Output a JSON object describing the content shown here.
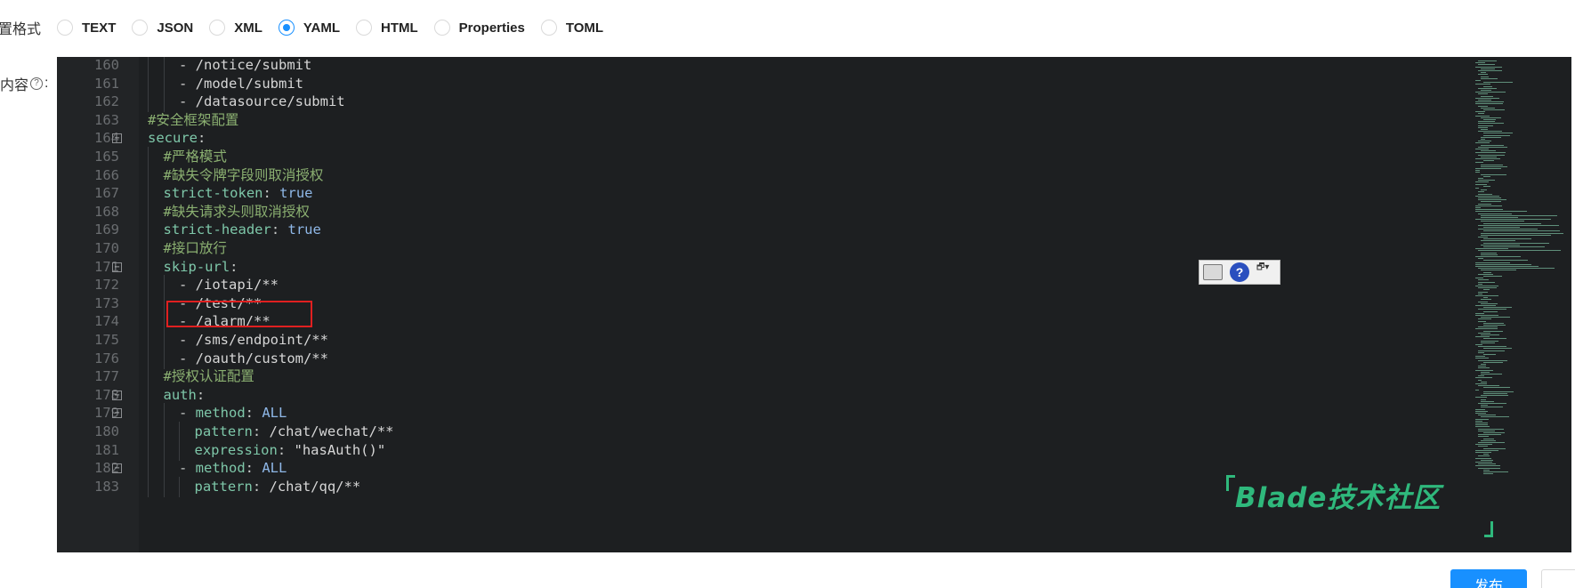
{
  "format": {
    "label": "置格式",
    "options": [
      {
        "label": "TEXT",
        "checked": false
      },
      {
        "label": "JSON",
        "checked": false
      },
      {
        "label": "XML",
        "checked": false
      },
      {
        "label": "YAML",
        "checked": true
      },
      {
        "label": "HTML",
        "checked": false
      },
      {
        "label": "Properties",
        "checked": false
      },
      {
        "label": "TOML",
        "checked": false
      }
    ]
  },
  "content": {
    "label": "内容",
    "help": "?",
    "colon": ":"
  },
  "editor": {
    "lines": [
      {
        "n": "160",
        "indent": 2,
        "text": "- /notice/submit",
        "type": "item"
      },
      {
        "n": "161",
        "indent": 2,
        "text": "- /model/submit",
        "type": "item"
      },
      {
        "n": "162",
        "indent": 2,
        "text": "- /datasource/submit",
        "type": "item"
      },
      {
        "n": "163",
        "indent": 0,
        "text": "#安全框架配置",
        "type": "comment"
      },
      {
        "n": "164",
        "indent": 0,
        "key": "secure",
        "fold": true,
        "type": "keyonly"
      },
      {
        "n": "165",
        "indent": 1,
        "text": "#严格模式",
        "type": "comment"
      },
      {
        "n": "166",
        "indent": 1,
        "text": "#缺失令牌字段则取消授权",
        "type": "comment"
      },
      {
        "n": "167",
        "indent": 1,
        "key": "strict-token",
        "val": "true",
        "type": "kv"
      },
      {
        "n": "168",
        "indent": 1,
        "text": "#缺失请求头则取消授权",
        "type": "comment"
      },
      {
        "n": "169",
        "indent": 1,
        "key": "strict-header",
        "val": "true",
        "type": "kv"
      },
      {
        "n": "170",
        "indent": 1,
        "text": "#接口放行",
        "type": "comment"
      },
      {
        "n": "171",
        "indent": 1,
        "key": "skip-url",
        "fold": true,
        "type": "keyonly"
      },
      {
        "n": "172",
        "indent": 2,
        "text": "- /iotapi/**",
        "type": "item"
      },
      {
        "n": "173",
        "indent": 2,
        "text": "- /test/**",
        "type": "item"
      },
      {
        "n": "174",
        "indent": 2,
        "text": "- /alarm/**",
        "type": "item"
      },
      {
        "n": "175",
        "indent": 2,
        "text": "- /sms/endpoint/**",
        "type": "item"
      },
      {
        "n": "176",
        "indent": 2,
        "text": "- /oauth/custom/**",
        "type": "item"
      },
      {
        "n": "177",
        "indent": 1,
        "text": "#授权认证配置",
        "type": "comment"
      },
      {
        "n": "178",
        "indent": 1,
        "key": "auth",
        "fold": true,
        "type": "keyonly"
      },
      {
        "n": "179",
        "indent": 2,
        "dash": true,
        "key": "method",
        "val": "ALL",
        "fold": true,
        "type": "kv"
      },
      {
        "n": "180",
        "indent": 3,
        "key": "pattern",
        "val": "/chat/wechat/**",
        "type": "kvplain"
      },
      {
        "n": "181",
        "indent": 3,
        "key": "expression",
        "val": "\"hasAuth()\"",
        "type": "kvplain"
      },
      {
        "n": "182",
        "indent": 2,
        "dash": true,
        "key": "method",
        "val": "ALL",
        "fold": true,
        "type": "kv"
      },
      {
        "n": "183",
        "indent": 3,
        "key": "pattern",
        "val": "/chat/qq/**",
        "type": "kvplain"
      }
    ]
  },
  "float_toolbar": {
    "help": "?",
    "restore": "🗗▾"
  },
  "watermark": "Blade技术社区",
  "publish_label": "发布",
  "colors": {
    "accent": "#1890ff",
    "highlight": "#e02020",
    "watermark": "#2fb87c"
  }
}
